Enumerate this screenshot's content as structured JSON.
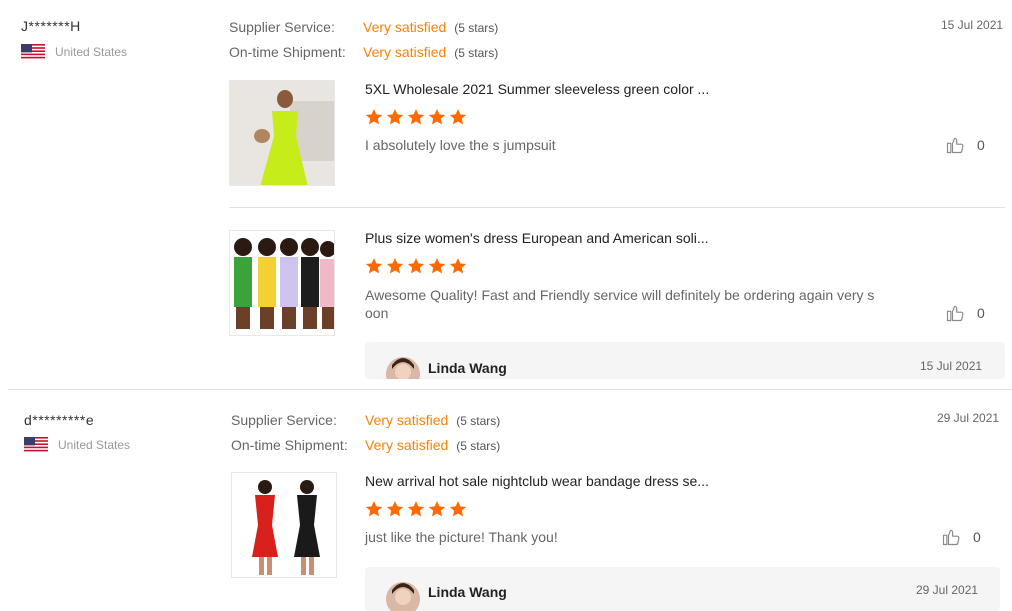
{
  "reviews": [
    {
      "buyer": "J*******H",
      "country": "United States",
      "supplier_service_label": "Supplier Service:",
      "supplier_service_value": "Very satisfied",
      "supplier_service_stars": "(5 stars)",
      "shipment_label": "On-time Shipment:",
      "shipment_value": "Very satisfied",
      "shipment_stars": "(5 stars)",
      "date": "15 Jul 2021",
      "items": [
        {
          "title": "5XL Wholesale 2021 Summer sleeveless green color ...",
          "rating": 5,
          "text": "I absolutely love the s jumpsuit",
          "likes": "0",
          "thumb_icon": "thumbs-up-icon"
        },
        {
          "title": "Plus size women's dress European and American soli...",
          "rating": 5,
          "text": "Awesome Quality! Fast and Friendly service will definitely be ordering again very s",
          "text_line2": "oon",
          "likes": "0",
          "thumb_icon": "thumbs-up-icon",
          "reply": {
            "name": "Linda Wang",
            "date": "15 Jul 2021"
          }
        }
      ]
    },
    {
      "buyer": "d*********e",
      "country": "United States",
      "supplier_service_label": "Supplier Service:",
      "supplier_service_value": "Very satisfied",
      "supplier_service_stars": "(5 stars)",
      "shipment_label": "On-time Shipment:",
      "shipment_value": "Very satisfied",
      "shipment_stars": "(5 stars)",
      "date": "29 Jul 2021",
      "items": [
        {
          "title": "New arrival hot sale nightclub wear bandage dress se...",
          "rating": 5,
          "text": "just like the picture! Thank you!",
          "likes": "0",
          "thumb_icon": "thumbs-up-icon",
          "reply": {
            "name": "Linda Wang",
            "date": "29 Jul 2021"
          }
        }
      ]
    }
  ],
  "colors": {
    "accent_orange": "#f7830a",
    "star_orange": "#ff6a00",
    "divider": "#e0e0e0"
  }
}
